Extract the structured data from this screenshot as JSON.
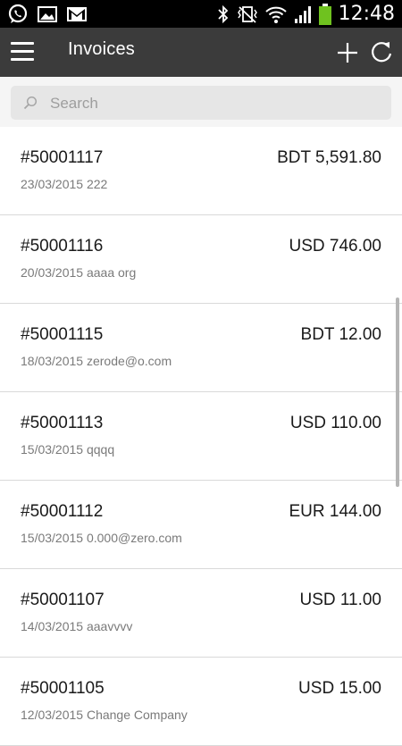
{
  "status_bar": {
    "time": "12:48",
    "left_icons": [
      "whatsapp-icon",
      "gallery-icon",
      "gmail-icon"
    ],
    "right_icons": [
      "bluetooth-icon",
      "vibrate-mute-icon",
      "wifi-icon",
      "signal-icon",
      "battery-icon"
    ],
    "battery_color": "#6fc21f"
  },
  "app_bar": {
    "title": "Invoices",
    "actions": [
      "add-icon",
      "refresh-icon"
    ]
  },
  "search": {
    "placeholder": "Search",
    "value": ""
  },
  "invoices": [
    {
      "number": "#50001117",
      "amount": "BDT 5,591.80",
      "subtitle": "23/03/2015 222"
    },
    {
      "number": "#50001116",
      "amount": "USD 746.00",
      "subtitle": "20/03/2015 aaaa org"
    },
    {
      "number": "#50001115",
      "amount": "BDT 12.00",
      "subtitle": "18/03/2015 zerode@o.com"
    },
    {
      "number": "#50001113",
      "amount": "USD 110.00",
      "subtitle": "15/03/2015 qqqq"
    },
    {
      "number": "#50001112",
      "amount": "EUR 144.00",
      "subtitle": "15/03/2015 0.000@zero.com"
    },
    {
      "number": "#50001107",
      "amount": "USD 11.00",
      "subtitle": "14/03/2015 aaavvvv"
    },
    {
      "number": "#50001105",
      "amount": "USD 15.00",
      "subtitle": "12/03/2015 Change Company"
    }
  ],
  "colors": {
    "app_bar": "#3b3b3b",
    "status_bar": "#000000",
    "divider": "#d9d9d9"
  }
}
